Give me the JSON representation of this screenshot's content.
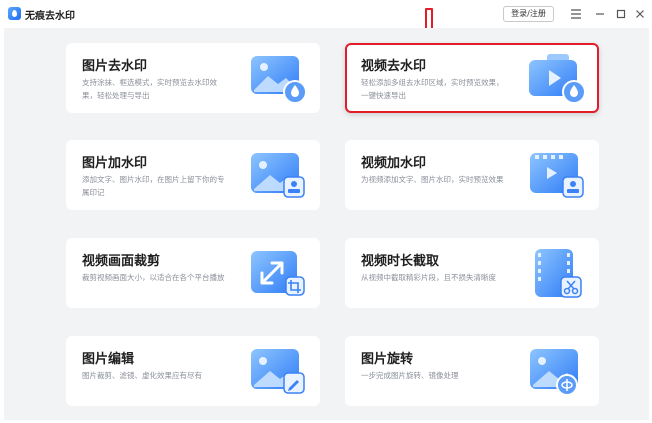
{
  "app": {
    "title": "无痕去水印",
    "login_label": "登录/注册"
  },
  "window_controls": [
    "menu-icon",
    "minimize-icon",
    "maximize-icon",
    "close-icon"
  ],
  "colors": {
    "accent": "#2f7cf6",
    "highlight_border": "#e11d2a",
    "background": "#f2f3f5"
  },
  "cards": [
    {
      "title": "图片去水印",
      "desc": "支持涂抹、框选模式，实时预览去水印效果，轻松处理与导出",
      "icon": "image-drop-icon"
    },
    {
      "title": "视频去水印",
      "desc": "轻松添加多组去水印区域，实时预览效果，一键快速导出",
      "icon": "video-drop-icon"
    },
    {
      "title": "图片加水印",
      "desc": "添加文字、图片水印，在图片上留下你的专属印记",
      "icon": "image-stamp-icon"
    },
    {
      "title": "视频加水印",
      "desc": "为视频添加文字、图片水印，实时预览效果",
      "icon": "video-stamp-icon"
    },
    {
      "title": "视频画面裁剪",
      "desc": "裁剪视频画面大小，以适合在各个平台播放",
      "icon": "crop-icon"
    },
    {
      "title": "视频时长截取",
      "desc": "从视频中截取精彩片段，且不损失清晰度",
      "icon": "film-cut-icon"
    },
    {
      "title": "图片编辑",
      "desc": "图片裁剪、滤镜、虚化效果应有尽有",
      "icon": "image-edit-icon"
    },
    {
      "title": "图片旋转",
      "desc": "一步完成图片旋转、镜像处理",
      "icon": "image-rotate-icon"
    }
  ]
}
